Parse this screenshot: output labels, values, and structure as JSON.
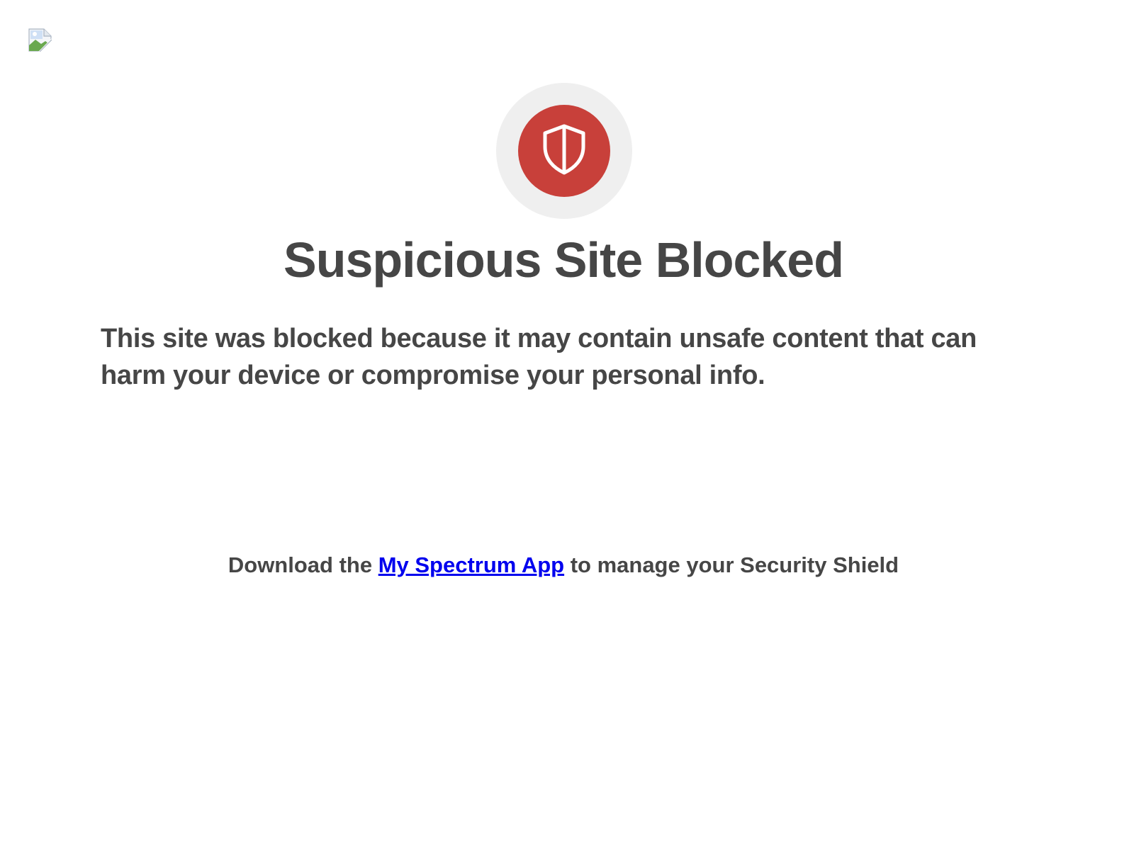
{
  "header": {
    "logo_alt": "",
    "logo_icon": "broken-image-icon"
  },
  "badge": {
    "icon": "shield-icon",
    "color": "#c8403a",
    "ring_color": "#efefef"
  },
  "title": "Suspicious Site Blocked",
  "description": "This site was blocked because it may contain unsafe content that can harm your device or compromise your personal info.",
  "download": {
    "prefix": "Download the ",
    "link_text": "My Spectrum App",
    "suffix": " to manage your Security Shield",
    "link_color": "#0000ee"
  },
  "colors": {
    "text": "#464646",
    "background": "#ffffff"
  }
}
